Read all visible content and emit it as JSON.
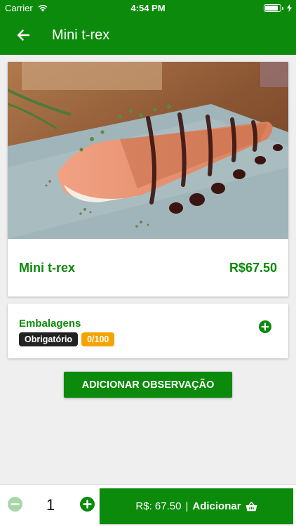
{
  "status_bar": {
    "carrier": "Carrier",
    "time": "4:54 PM"
  },
  "header": {
    "title": "Mini t-rex"
  },
  "product": {
    "name": "Mini t-rex",
    "price": "R$67.50",
    "image_icon": "food-photo"
  },
  "options": {
    "title": "Embalagens",
    "required_label": "Obrigatório",
    "count": "0/100"
  },
  "observation_button": {
    "label": "ADICIONAR OBSERVAÇÃO"
  },
  "cart": {
    "quantity": "1",
    "total_label": "R$: 67.50",
    "separator": "|",
    "add_label": "Adicionar"
  },
  "colors": {
    "primary": "#0b8a0b",
    "badge_dark": "#222222",
    "badge_orange": "#f5a300",
    "background": "#efefef"
  }
}
